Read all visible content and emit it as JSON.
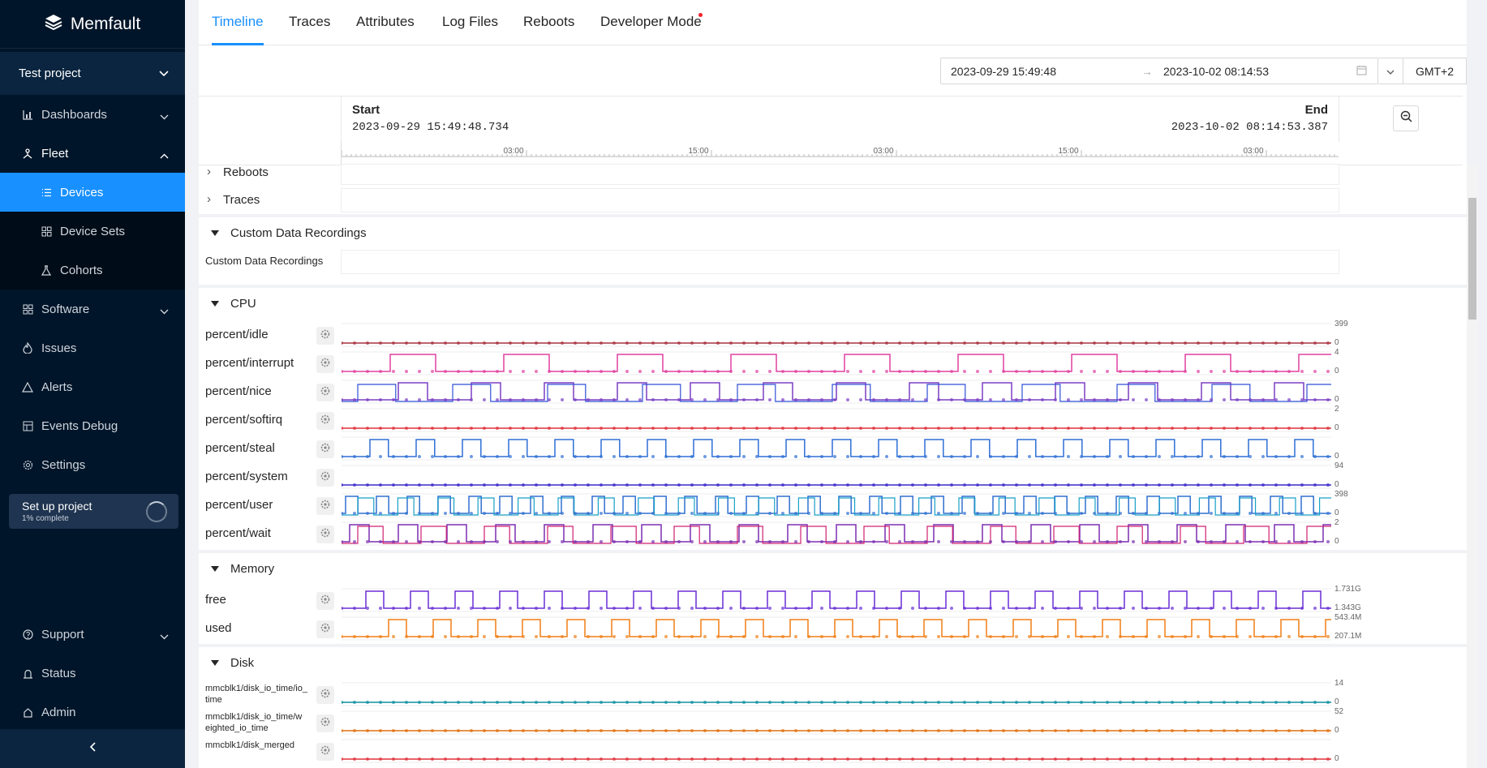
{
  "app": {
    "name": "Memfault"
  },
  "project": {
    "name": "Test project"
  },
  "nav": {
    "items": [
      {
        "label": "Dashboards",
        "icon": "bar-chart-icon",
        "has_submenu": true
      },
      {
        "label": "Fleet",
        "icon": "fleet-icon",
        "has_submenu": true,
        "expanded": true
      },
      {
        "label": "Software",
        "icon": "grid-icon",
        "has_submenu": true
      },
      {
        "label": "Issues",
        "icon": "flame-icon"
      },
      {
        "label": "Alerts",
        "icon": "alert-icon"
      },
      {
        "label": "Events Debug",
        "icon": "events-icon"
      },
      {
        "label": "Settings",
        "icon": "gear-icon"
      }
    ],
    "fleet_sub": [
      {
        "label": "Devices",
        "icon": "list-icon",
        "active": true
      },
      {
        "label": "Device Sets",
        "icon": "device-sets-icon"
      },
      {
        "label": "Cohorts",
        "icon": "flask-icon"
      }
    ],
    "bottom": [
      {
        "label": "Support",
        "icon": "help-icon",
        "has_submenu": true
      },
      {
        "label": "Status",
        "icon": "status-icon"
      },
      {
        "label": "Admin",
        "icon": "admin-icon"
      }
    ]
  },
  "setup": {
    "title": "Set up project",
    "progress_text": "1% complete",
    "progress": 0.01
  },
  "tabs": [
    "Timeline",
    "Traces",
    "Attributes",
    "Log Files",
    "Reboots",
    "Developer Mode"
  ],
  "active_tab": "Timeline",
  "range": {
    "start": "2023-09-29 15:49:48",
    "end": "2023-10-02 08:14:53",
    "tz": "GMT+2"
  },
  "timeline": {
    "start_label": "Start",
    "end_label": "End",
    "start": "2023-09-29 15:49:48.734",
    "end": "2023-10-02 08:14:53.387",
    "ticks": [
      "03:00",
      "15:00",
      "03:00",
      "15:00",
      "03:00"
    ]
  },
  "event_rows": [
    "Reboots",
    "Traces"
  ],
  "sections": {
    "custom": {
      "title": "Custom Data Recordings",
      "row": "Custom Data Recordings"
    },
    "cpu": {
      "title": "CPU",
      "metrics": [
        {
          "name": "percent/idle",
          "max": "399",
          "min": "0"
        },
        {
          "name": "percent/interrupt",
          "max": "4",
          "min": "0"
        },
        {
          "name": "percent/nice",
          "max": "",
          "min": "0"
        },
        {
          "name": "percent/softirq",
          "max": "2",
          "min": "0"
        },
        {
          "name": "percent/steal",
          "max": "",
          "min": "0"
        },
        {
          "name": "percent/system",
          "max": "94",
          "min": "0"
        },
        {
          "name": "percent/user",
          "max": "398",
          "min": "0"
        },
        {
          "name": "percent/wait",
          "max": "2",
          "min": "0"
        }
      ]
    },
    "memory": {
      "title": "Memory",
      "metrics": [
        {
          "name": "free",
          "max": "1.731G",
          "min": "1.343G"
        },
        {
          "name": "used",
          "max": "543.4M",
          "min": "207.1M"
        }
      ]
    },
    "disk": {
      "title": "Disk",
      "metrics": [
        {
          "name": "mmcblk1/disk_io_time/io_time",
          "line1": "mmcblk1/disk_io_time/io_",
          "line2": "time",
          "max": "14",
          "min": "0"
        },
        {
          "name": "mmcblk1/disk_io_time/weighted_io_time",
          "line1": "mmcblk1/disk_io_time/w",
          "line2": "eighted_io_time",
          "max": "52",
          "min": "0"
        },
        {
          "name": "mmcblk1/disk_merged",
          "line1": "mmcblk1/disk_merged",
          "line2": "",
          "max": "",
          "min": "0"
        }
      ]
    }
  },
  "colors": {
    "accent": "#1890ff",
    "sidebar": "#001529"
  }
}
